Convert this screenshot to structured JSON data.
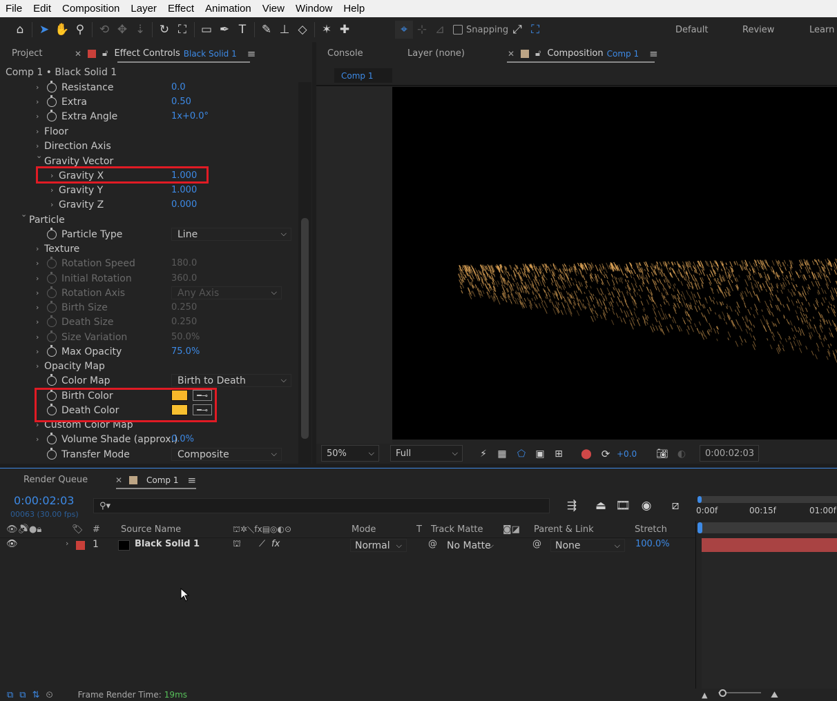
{
  "menu": [
    "File",
    "Edit",
    "Composition",
    "Layer",
    "Effect",
    "Animation",
    "View",
    "Window",
    "Help"
  ],
  "toolbar": {
    "snapping_label": "Snapping",
    "workspaces": [
      "Default",
      "Review",
      "Learn"
    ]
  },
  "left_panel": {
    "tab_project": "Project",
    "tab_effect_controls": "Effect Controls",
    "effect_layer_name": "Black Solid 1",
    "breadcrumb": "Comp 1 • Black Solid 1",
    "properties": [
      {
        "label": "Resistance",
        "value": "0.0"
      },
      {
        "label": "Extra",
        "value": "0.50"
      },
      {
        "label": "Extra Angle",
        "value": "1x+0.0°"
      },
      {
        "label": "Floor",
        "value": ""
      },
      {
        "label": "Direction Axis",
        "value": ""
      },
      {
        "label": "Gravity Vector",
        "value": ""
      },
      {
        "label": "Gravity X",
        "value": "1.000"
      },
      {
        "label": "Gravity Y",
        "value": "1.000"
      },
      {
        "label": "Gravity Z",
        "value": "0.000"
      },
      {
        "label": "Particle",
        "value": ""
      },
      {
        "label": "Particle Type",
        "value": "Line"
      },
      {
        "label": "Texture",
        "value": ""
      },
      {
        "label": "Rotation Speed",
        "value": "180.0"
      },
      {
        "label": "Initial Rotation",
        "value": "360.0"
      },
      {
        "label": "Rotation Axis",
        "value": "Any Axis"
      },
      {
        "label": "Birth Size",
        "value": "0.250"
      },
      {
        "label": "Death Size",
        "value": "0.250"
      },
      {
        "label": "Size Variation",
        "value": "50.0%"
      },
      {
        "label": "Max Opacity",
        "value": "75.0%"
      },
      {
        "label": "Opacity Map",
        "value": ""
      },
      {
        "label": "Color Map",
        "value": "Birth to Death"
      },
      {
        "label": "Birth Color",
        "value": "#f8b72a"
      },
      {
        "label": "Death Color",
        "value": "#f8c030"
      },
      {
        "label": "Custom Color Map",
        "value": ""
      },
      {
        "label": "Volume Shade (approx.)",
        "value": "0.0%"
      },
      {
        "label": "Transfer Mode",
        "value": "Composite"
      }
    ]
  },
  "right_panel": {
    "tab_console": "Console",
    "tab_layer": "Layer (none)",
    "tab_composition": "Composition",
    "comp_name": "Comp 1",
    "viewer_tab": "Comp 1",
    "zoom": "50%",
    "resolution": "Full",
    "exposure": "+0.0",
    "timecode": "0:00:02:03"
  },
  "timeline": {
    "tab_render_queue": "Render Queue",
    "tab_comp": "Comp 1",
    "current_time": "0:00:02:03",
    "frame_info": "00063 (30.00 fps)",
    "search_placeholder": "",
    "columns": {
      "number": "#",
      "source_name": "Source Name",
      "mode": "Mode",
      "t": "T",
      "track_matte": "Track Matte",
      "parent_link": "Parent & Link",
      "stretch": "Stretch"
    },
    "ruler": [
      "0:00f",
      "00:15f",
      "01:00f"
    ],
    "layer": {
      "number": "1",
      "name": "Black Solid 1",
      "mode": "Normal",
      "track_matte": "No Matte",
      "parent": "None",
      "stretch": "100.0%",
      "label_color": "#c9403a"
    }
  },
  "status": {
    "label": "Frame Render Time:",
    "value": "19ms"
  }
}
